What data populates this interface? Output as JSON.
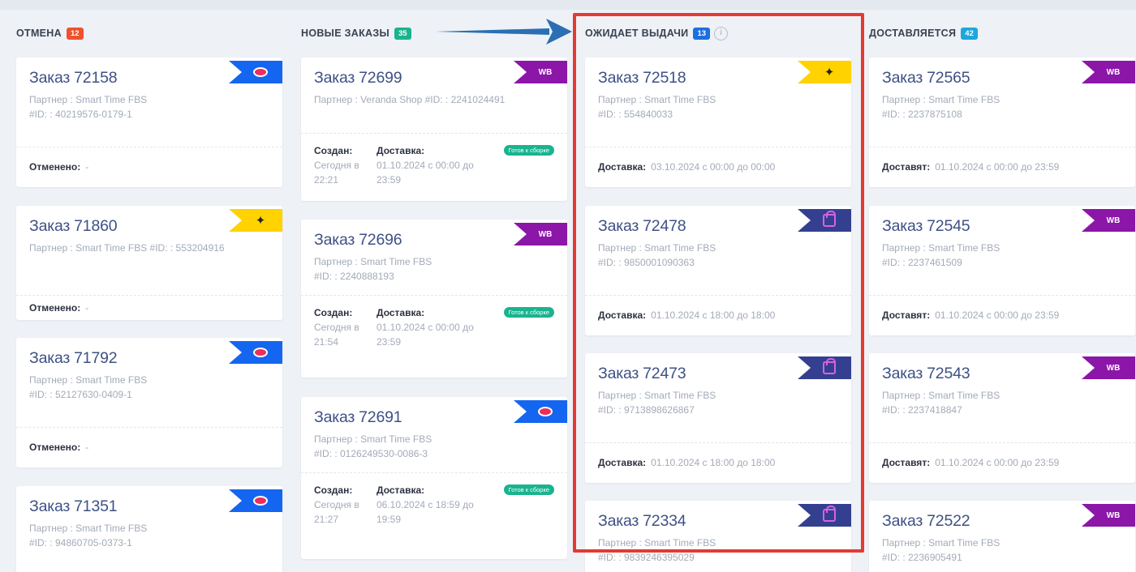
{
  "columns": [
    {
      "title": "ОТМЕНА",
      "count": "12",
      "count_color": "#f0512e",
      "cards": [
        {
          "word": "Заказ",
          "num": "72158",
          "marketplace": "ozon",
          "partner_line": "Партнер : Smart Time FBS",
          "id_line": "#ID: : 40219576-0179-1",
          "foot_label": "Отменено:",
          "foot_value": "-"
        },
        {
          "word": "Заказ",
          "num": "71860",
          "marketplace": "ym",
          "partner_line": "Партнер : Smart Time FBS   #ID: : 553204916",
          "id_line": "",
          "foot_label": "Отменено:",
          "foot_value": "-"
        },
        {
          "word": "Заказ",
          "num": "71792",
          "marketplace": "ozon",
          "partner_line": "Партнер : Smart Time FBS",
          "id_line": "#ID: : 52127630-0409-1",
          "foot_label": "Отменено:",
          "foot_value": "-"
        },
        {
          "word": "Заказ",
          "num": "71351",
          "marketplace": "ozon",
          "partner_line": "Партнер : Smart Time FBS",
          "id_line": "#ID: : 94860705-0373-1"
        }
      ]
    },
    {
      "title": "НОВЫЕ ЗАКАЗЫ",
      "count": "35",
      "count_color": "#19b48e",
      "cards": [
        {
          "word": "Заказ",
          "num": "72699",
          "marketplace": "wb",
          "partner_line": "Партнер : Veranda Shop   #ID: : 2241024491",
          "id_line": "",
          "created_label": "Создан:",
          "created_value": "Сегодня в 22:21",
          "delivery_label": "Доставка:",
          "delivery_value": "01.10.2024 с 00:00 до 23:59",
          "status": "Готов к сборке"
        },
        {
          "word": "Заказ",
          "num": "72696",
          "marketplace": "wb",
          "partner_line": "Партнер : Smart Time FBS",
          "id_line": "#ID: : 2240888193",
          "created_label": "Создан:",
          "created_value": "Сегодня в 21:54",
          "delivery_label": "Доставка:",
          "delivery_value": "01.10.2024 с 00:00 до 23:59",
          "status": "Готов к сборке"
        },
        {
          "word": "Заказ",
          "num": "72691",
          "marketplace": "ozon",
          "partner_line": "Партнер : Smart Time FBS",
          "id_line": "#ID: : 0126249530-0086-3",
          "created_label": "Создан:",
          "created_value": "Сегодня в 21:27",
          "delivery_label": "Доставка:",
          "delivery_value": "06.10.2024 с 18:59 до 19:59",
          "status": "Готов к сборке"
        }
      ]
    },
    {
      "title": "ОЖИДАЕТ ВЫДАЧИ",
      "count": "13",
      "count_color": "#1c6fe0",
      "has_info": true,
      "cards": [
        {
          "word": "Заказ",
          "num": "72518",
          "marketplace": "ym",
          "partner_line": "Партнер : Smart Time FBS",
          "id_line": "#ID: : 554840033",
          "foot_label": "Доставка:",
          "foot_value": "03.10.2024 с 00:00 до 00:00"
        },
        {
          "word": "Заказ",
          "num": "72478",
          "marketplace": "mm",
          "partner_line": "Партнер : Smart Time FBS",
          "id_line": "#ID: : 9850001090363",
          "foot_label": "Доставка:",
          "foot_value": "01.10.2024 с 18:00 до 18:00"
        },
        {
          "word": "Заказ",
          "num": "72473",
          "marketplace": "mm",
          "partner_line": "Партнер : Smart Time FBS",
          "id_line": "#ID: : 9713898626867",
          "foot_label": "Доставка:",
          "foot_value": "01.10.2024 с 18:00 до 18:00"
        },
        {
          "word": "Заказ",
          "num": "72334",
          "marketplace": "mm",
          "partner_line": "Партнер : Smart Time FBS",
          "id_line": "#ID: : 9839246395029"
        }
      ]
    },
    {
      "title": "ДОСТАВЛЯЕТСЯ",
      "count": "42",
      "count_color": "#1ea6dd",
      "cards": [
        {
          "word": "Заказ",
          "num": "72565",
          "marketplace": "wb",
          "partner_line": "Партнер : Smart Time FBS",
          "id_line": "#ID: : 2237875108",
          "foot_label": "Доставят:",
          "foot_value": "01.10.2024 с 00:00 до 23:59"
        },
        {
          "word": "Заказ",
          "num": "72545",
          "marketplace": "wb",
          "partner_line": "Партнер : Smart Time FBS",
          "id_line": "#ID: : 2237461509",
          "foot_label": "Доставят:",
          "foot_value": "01.10.2024 с 00:00 до 23:59"
        },
        {
          "word": "Заказ",
          "num": "72543",
          "marketplace": "wb",
          "partner_line": "Партнер : Smart Time FBS",
          "id_line": "#ID: : 2237418847",
          "foot_label": "Доставят:",
          "foot_value": "01.10.2024 с 00:00 до 23:59"
        },
        {
          "word": "Заказ",
          "num": "72522",
          "marketplace": "wb",
          "partner_line": "Партнер : Smart Time FBS",
          "id_line": "#ID: : 2236905491"
        }
      ]
    }
  ],
  "marketplace_labels": {
    "wb": "WB"
  },
  "marketplace_icons": {
    "ozon": "ozon-logo-icon",
    "wb": "wildberries-logo-icon",
    "ym": "yandex-market-logo-icon",
    "mm": "megamarket-bag-icon"
  },
  "info_icon_glyph": "i",
  "colors": {
    "highlight": "#e23b34",
    "arrow": "#2a6fb4",
    "ozon": "#1466f0",
    "wb": "#8b16a8",
    "ym": "#ffd200",
    "mm": "#34408f",
    "ready": "#19b48e"
  }
}
